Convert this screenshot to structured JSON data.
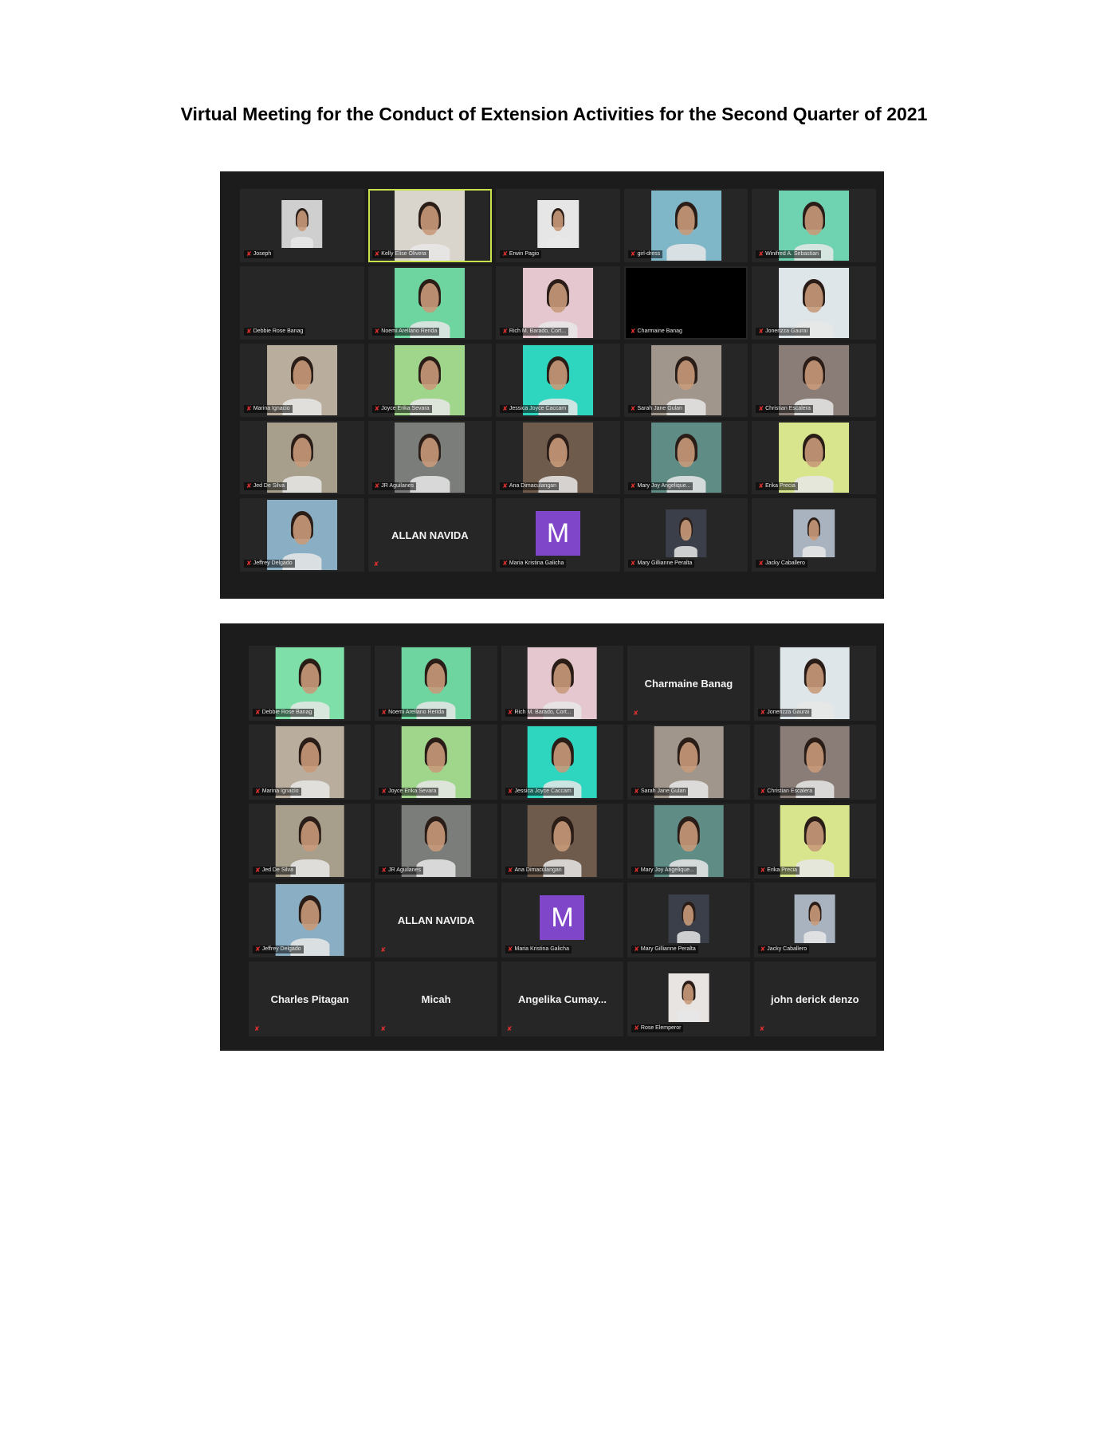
{
  "document": {
    "title": "Virtual Meeting for the Conduct of Extension Activities for the Second Quarter of 2021"
  },
  "icons": {
    "muted_mic": "muted-mic-icon"
  },
  "screenshot1": {
    "tiles": [
      {
        "name": "Joseph",
        "kind": "avatar",
        "color": "#cfcfcf"
      },
      {
        "name": "Kelly Elise Olivera",
        "kind": "video",
        "color": "#d9d4cc",
        "active": true
      },
      {
        "name": "Erwin Pagio",
        "kind": "photo",
        "color": "#e6e6e6"
      },
      {
        "name": "girl-dress",
        "kind": "video",
        "color": "#7fb7c9"
      },
      {
        "name": "Winifred A. Sebastian",
        "kind": "video",
        "color": "#6fd3b1"
      },
      {
        "name": "Debbie Rose Banag",
        "kind": "none",
        "color": "#262626"
      },
      {
        "name": "Noemi Arellano Rerida",
        "kind": "video",
        "color": "#6ed4a0"
      },
      {
        "name": "Rich M. Barado, Cort...",
        "kind": "video",
        "color": "#e4c7cf"
      },
      {
        "name": "Charmaine Banag",
        "kind": "black",
        "color": "#000000"
      },
      {
        "name": "Jonerizza Gaurai",
        "kind": "video",
        "color": "#dfe6ea"
      },
      {
        "name": "Marina Ignacio",
        "kind": "video",
        "color": "#b9ae9d"
      },
      {
        "name": "Joyce Erika Sevara",
        "kind": "video",
        "color": "#9fd68c"
      },
      {
        "name": "Jessica Joyce Caccam",
        "kind": "video",
        "color": "#2ed6bf"
      },
      {
        "name": "Sarah Jane Gulan",
        "kind": "video",
        "color": "#a0968b"
      },
      {
        "name": "Christian Escalera",
        "kind": "video",
        "color": "#8a7d78"
      },
      {
        "name": "Jed De Silva",
        "kind": "video",
        "color": "#a79f8c"
      },
      {
        "name": "JR Aguilanes",
        "kind": "video",
        "color": "#7b7d7a"
      },
      {
        "name": "Ana Dimaculangan",
        "kind": "video",
        "color": "#6f5b4c"
      },
      {
        "name": "Mary Joy Angelique...",
        "kind": "video",
        "color": "#5f8d86"
      },
      {
        "name": "Erika Precia",
        "kind": "video",
        "color": "#d8e58c"
      },
      {
        "name": "Jeffrey Delgado",
        "kind": "video",
        "color": "#8aaec4"
      },
      {
        "name": "ALLAN NAVIDA",
        "kind": "text",
        "color": "#262626"
      },
      {
        "name": "Maria Kristina Galicha",
        "kind": "letter",
        "letter": "M",
        "color": "#8046c9"
      },
      {
        "name": "Mary Gillianne Peralta",
        "kind": "small",
        "color": "#3b3f4a"
      },
      {
        "name": "Jacky Caballero",
        "kind": "small",
        "color": "#a9b3c0"
      }
    ]
  },
  "screenshot2": {
    "tiles": [
      {
        "name": "Debbie Rose Banag",
        "kind": "video",
        "color": "#7ee0a8"
      },
      {
        "name": "Noemi Arellano Rerida",
        "kind": "video",
        "color": "#6ed4a0"
      },
      {
        "name": "Rich M. Barado, Cort...",
        "kind": "video",
        "color": "#e4c7cf"
      },
      {
        "name": "Charmaine Banag",
        "kind": "text",
        "color": "#262626"
      },
      {
        "name": "Jonerizza Gaurai",
        "kind": "video",
        "color": "#dfe6ea"
      },
      {
        "name": "Marina Ignacio",
        "kind": "video",
        "color": "#b9ae9d"
      },
      {
        "name": "Joyce Erika Sevara",
        "kind": "video",
        "color": "#9fd68c"
      },
      {
        "name": "Jessica Joyce Caccam",
        "kind": "video",
        "color": "#2ed6bf"
      },
      {
        "name": "Sarah Jane Gulan",
        "kind": "video",
        "color": "#a0968b"
      },
      {
        "name": "Christian Escalera",
        "kind": "video",
        "color": "#8a7d78"
      },
      {
        "name": "Jed De Silva",
        "kind": "video",
        "color": "#a79f8c"
      },
      {
        "name": "JR Aguilanes",
        "kind": "video",
        "color": "#7b7d7a"
      },
      {
        "name": "Ana Dimaculangan",
        "kind": "video",
        "color": "#6f5b4c"
      },
      {
        "name": "Mary Joy Angelique...",
        "kind": "video",
        "color": "#5f8d86"
      },
      {
        "name": "Erika Precia",
        "kind": "video",
        "color": "#d8e58c"
      },
      {
        "name": "Jeffrey Delgado",
        "kind": "video",
        "color": "#8aaec4"
      },
      {
        "name": "ALLAN NAVIDA",
        "kind": "text",
        "color": "#262626"
      },
      {
        "name": "Maria Kristina Galicha",
        "kind": "letter",
        "letter": "M",
        "color": "#8046c9"
      },
      {
        "name": "Mary Gillianne Peralta",
        "kind": "small",
        "color": "#3b3f4a"
      },
      {
        "name": "Jacky Caballero",
        "kind": "small",
        "color": "#a9b3c0"
      },
      {
        "name": "Charles Pitagan",
        "kind": "text",
        "color": "#262626"
      },
      {
        "name": "Micah",
        "kind": "text",
        "color": "#262626"
      },
      {
        "name": "Angelika Cumay...",
        "kind": "text",
        "color": "#262626"
      },
      {
        "name": "Rose Elemperor",
        "kind": "small",
        "color": "#e8e4e2"
      },
      {
        "name": "john derick denzo",
        "kind": "text",
        "color": "#262626"
      }
    ]
  }
}
